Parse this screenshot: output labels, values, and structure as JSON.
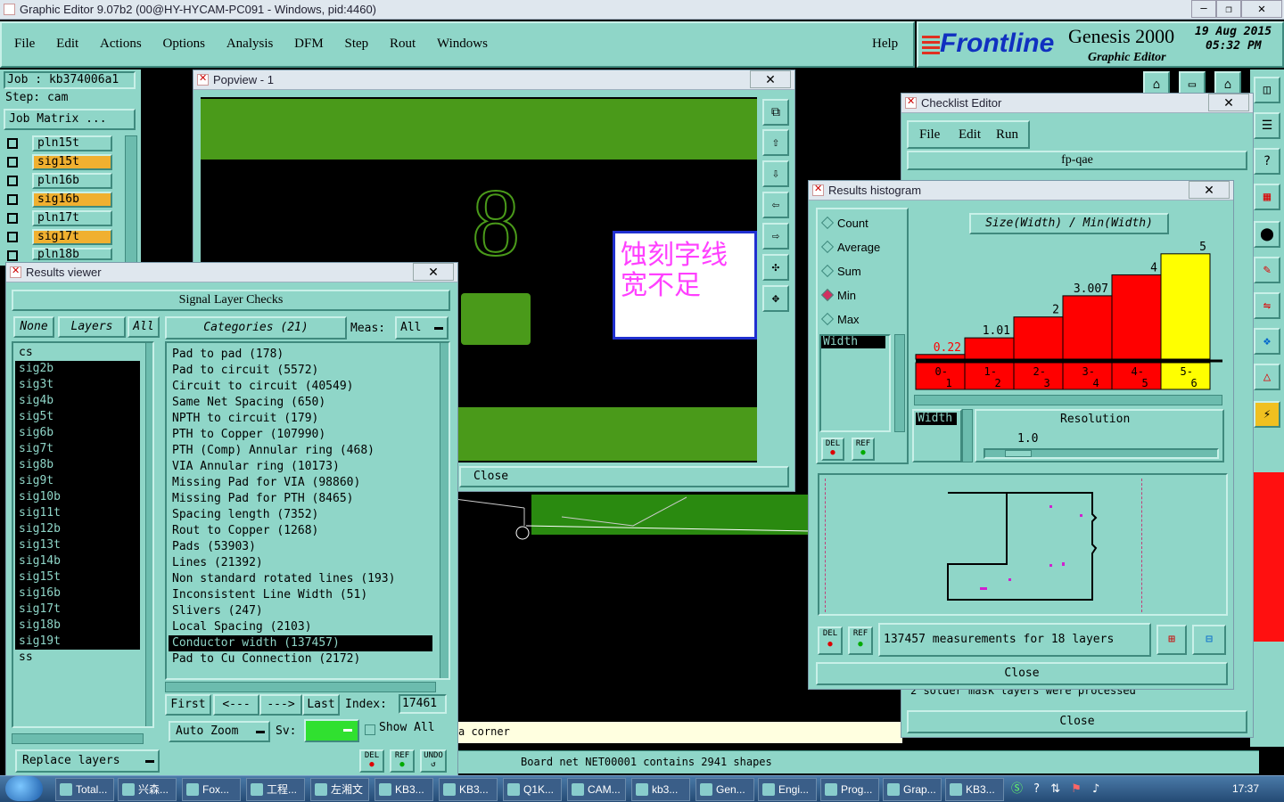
{
  "app": {
    "title": "Graphic Editor 9.07b2 (00@HY-HYCAM-PC091 - Windows, pid:4460)",
    "menu": [
      "File",
      "Edit",
      "Actions",
      "Options",
      "Analysis",
      "DFM",
      "Step",
      "Rout",
      "Windows"
    ],
    "help": "Help",
    "brand": "Frontline",
    "product": "Genesis 2000",
    "product_sub": "Graphic Editor",
    "date": "19 Aug 2015",
    "time": "05:32 PM"
  },
  "job": {
    "job_label": "Job : kb374006a1",
    "step_label": "Step: cam",
    "matrix_button": "Job Matrix ...",
    "layers": [
      "pln15t",
      "sig15t",
      "pln16b",
      "sig16b",
      "pln17t",
      "sig17t",
      "pln18b"
    ]
  },
  "popview": {
    "title": "Popview - 1",
    "annotation": "蚀刻字线宽不足",
    "digit": "8",
    "close": "Close"
  },
  "results_viewer": {
    "title": "Results viewer",
    "header": "Signal Layer Checks",
    "none": "None",
    "layers": "Layers",
    "all": "All",
    "categories": "Categories (21)",
    "meas_label": "Meas:",
    "meas_value": "All",
    "layer_list": [
      "cs",
      "sig2b",
      "sig3t",
      "sig4b",
      "sig5t",
      "sig6b",
      "sig7t",
      "sig8b",
      "sig9t",
      "sig10b",
      "sig11t",
      "sig12b",
      "sig13t",
      "sig14b",
      "sig15t",
      "sig16b",
      "sig17t",
      "sig18b",
      "sig19t",
      "ss"
    ],
    "category_list": [
      "Pad to pad (178)",
      "Pad to circuit (5572)",
      "Circuit to circuit (40549)",
      "Same Net Spacing (650)",
      "NPTH to circuit (179)",
      "PTH to Copper (107990)",
      "PTH (Comp) Annular ring (468)",
      "VIA Annular ring (10173)",
      "Missing Pad for VIA (98860)",
      "Missing Pad for PTH (8465)",
      "Spacing length (7352)",
      "Rout to Copper (1268)",
      "Pads (53903)",
      "Lines (21392)",
      "Non standard rotated lines (193)",
      "Inconsistent Line Width (51)",
      "Slivers (247)",
      "Local Spacing (2103)",
      "Conductor width (137457)",
      "Pad to Cu Connection (2172)"
    ],
    "first": "First",
    "prev": "<---",
    "next": "--->",
    "last": "Last",
    "index_label": "Index:",
    "index_value": "17461",
    "auto_zoom": "Auto Zoom",
    "sv_label": "Sv:",
    "show_all": "Show All",
    "replace_layers": "Replace layers",
    "del": "DEL",
    "ref": "REF",
    "undo": "UNDO"
  },
  "checklist": {
    "title": "Checklist Editor",
    "menu": [
      "File",
      "Edit",
      "Run"
    ],
    "name": "fp-qae",
    "status_text": "2 solder mask layers were processed",
    "close": "Close"
  },
  "histogram": {
    "title": "Results histogram",
    "modes": [
      "Count",
      "Average",
      "Sum",
      "Min",
      "Max"
    ],
    "selected_mode": "Min",
    "attr_list_item": "Width",
    "chart_title": "Size(Width) / Min(Width)",
    "resolution_label": "Resolution",
    "resolution_attr": "Width",
    "resolution_value": "1.0",
    "summary": "137457 measurements for 18 layers",
    "close": "Close",
    "del": "DEL",
    "ref": "REF"
  },
  "chart_data": {
    "type": "bar",
    "title": "Size(Width) / Min(Width)",
    "categories": [
      "0-1",
      "1-2",
      "2-3",
      "3-4",
      "4-5",
      "5-6"
    ],
    "values": [
      0.22,
      1.01,
      2,
      3.007,
      4,
      5
    ],
    "value_labels": [
      "0.22",
      "1.01",
      "2",
      "3.007",
      "4",
      "5"
    ],
    "ylim": [
      0,
      5.5
    ],
    "colors": {
      "bar": "#ff0000",
      "highlight": "#ffff00"
    },
    "highlight_index": 5
  },
  "status": {
    "corner_text": "a corner",
    "message": "Board net NET00001 contains 2941 shapes"
  },
  "taskbar": {
    "items": [
      "Total...",
      "兴森...",
      "Fox...",
      "工程...",
      "左湘文",
      "KB3...",
      "KB3...",
      "Q1K...",
      "CAM...",
      "kb3...",
      "Gen...",
      "Engi...",
      "Prog...",
      "Grap...",
      "KB3..."
    ],
    "clock": "17:37"
  }
}
